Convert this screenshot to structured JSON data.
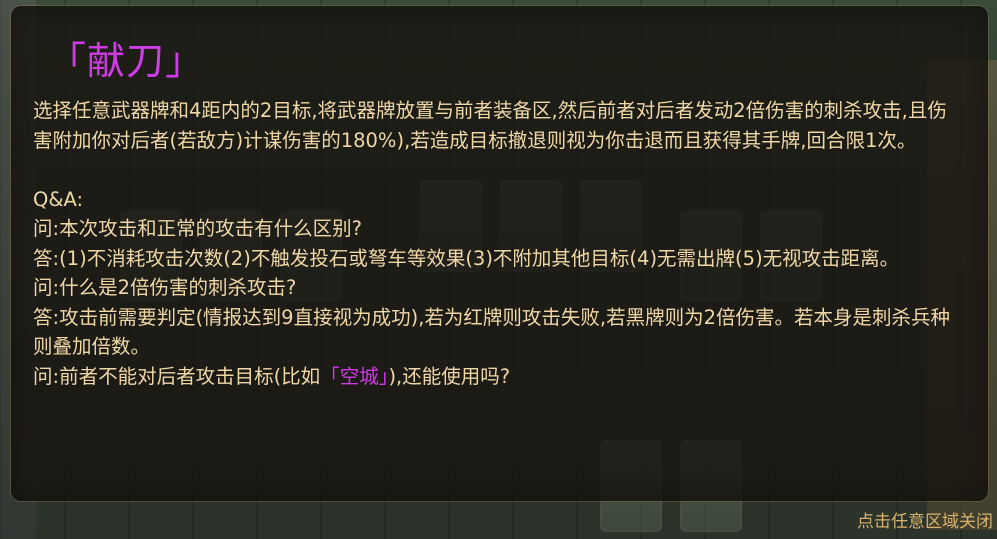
{
  "skill_popup": {
    "title": "「献刀」",
    "description": "选择任意武器牌和4距内的2目标,将武器牌放置与前者装备区,然后前者对后者发动2倍伤害的刺杀攻击,且伤害附加你对后者(若敌方)计谋伤害的180%),若造成目标撤退则视为你击退而且获得其手牌,回合限1次。",
    "qa_heading": "Q&A:",
    "q1": "问:本次攻击和正常的攻击有什么区别?",
    "a1": "答:(1)不消耗攻击次数(2)不触发投石或弩车等效果(3)不附加其他目标(4)无需出牌(5)无视攻击距离。",
    "q2": "问:什么是2倍伤害的刺杀攻击?",
    "a2": "答:攻击前需要判定(情报达到9直接视为成功),若为红牌则攻击失败,若黑牌则为2倍伤害。若本身是刺杀兵种则叠加倍数。",
    "q3_prefix": "问:前者不能对后者攻击目标(比如",
    "q3_highlight": "「空城」",
    "q3_suffix": "),还能使用吗?"
  },
  "close_hint": "点击任意区域关闭",
  "colors": {
    "title": "#d13ae8",
    "body_text": "#f0d7a6",
    "close_hint": "#d9b26a",
    "overlay": "rgba(24,20,16,0.80)"
  }
}
